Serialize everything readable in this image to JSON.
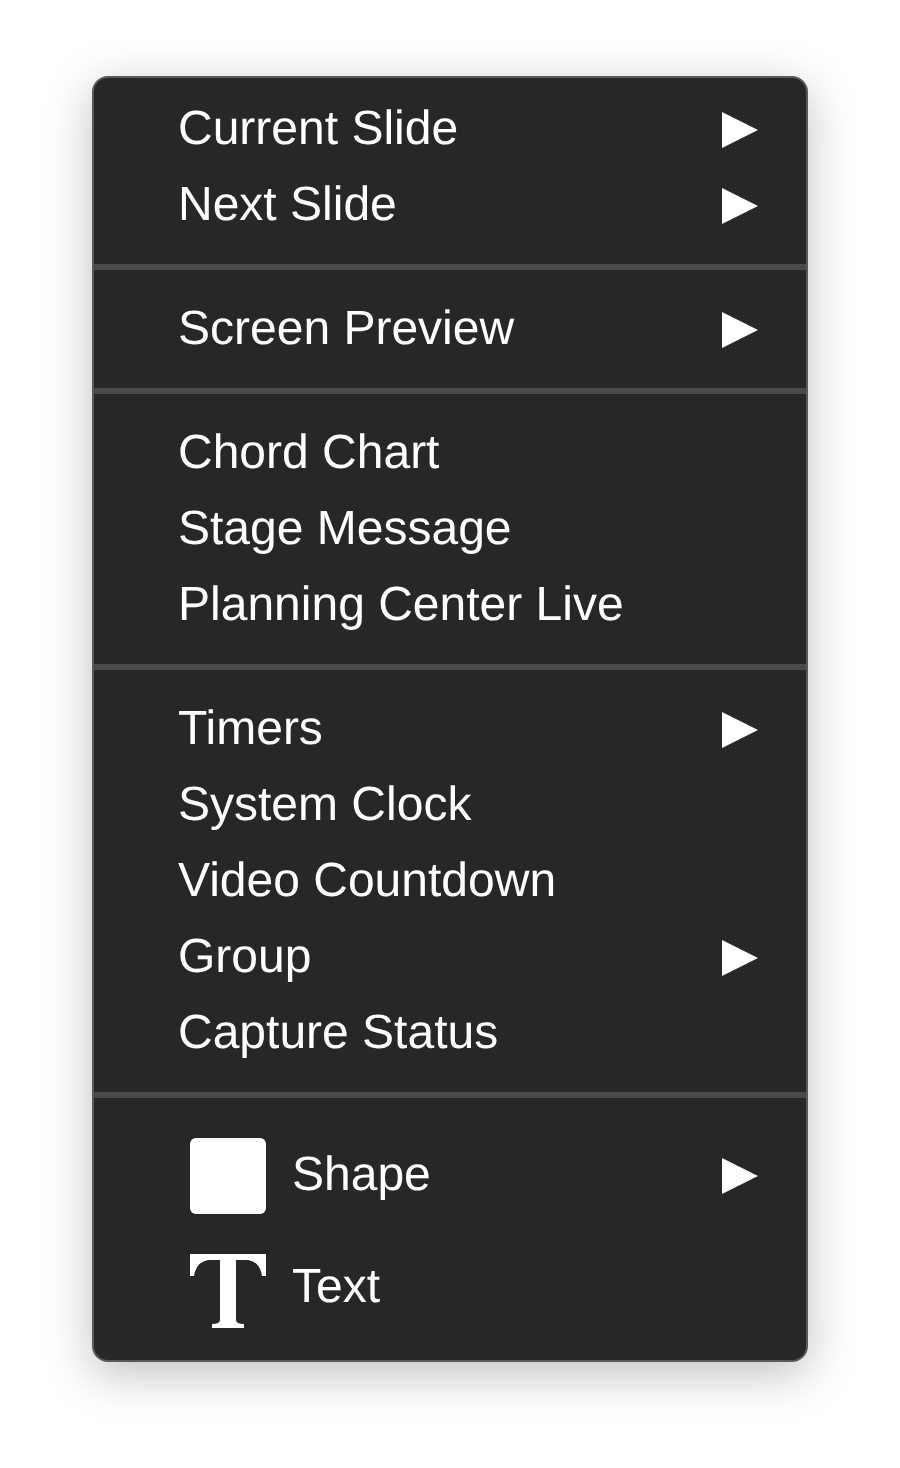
{
  "menu": {
    "sections": [
      {
        "items": [
          {
            "label": "Current Slide",
            "submenu": true,
            "kind": "plain"
          },
          {
            "label": "Next Slide",
            "submenu": true,
            "kind": "plain"
          }
        ]
      },
      {
        "items": [
          {
            "label": "Screen Preview",
            "submenu": true,
            "kind": "plain"
          }
        ]
      },
      {
        "items": [
          {
            "label": "Chord Chart",
            "submenu": false,
            "kind": "plain"
          },
          {
            "label": "Stage Message",
            "submenu": false,
            "kind": "plain"
          },
          {
            "label": "Planning Center Live",
            "submenu": false,
            "kind": "plain"
          }
        ]
      },
      {
        "items": [
          {
            "label": "Timers",
            "submenu": true,
            "kind": "plain"
          },
          {
            "label": "System Clock",
            "submenu": false,
            "kind": "plain"
          },
          {
            "label": "Video Countdown",
            "submenu": false,
            "kind": "plain"
          },
          {
            "label": "Group",
            "submenu": true,
            "kind": "plain"
          },
          {
            "label": "Capture Status",
            "submenu": false,
            "kind": "plain"
          }
        ]
      },
      {
        "items": [
          {
            "label": "Shape",
            "submenu": true,
            "kind": "shape"
          },
          {
            "label": "Text",
            "submenu": false,
            "kind": "text"
          }
        ]
      }
    ]
  }
}
